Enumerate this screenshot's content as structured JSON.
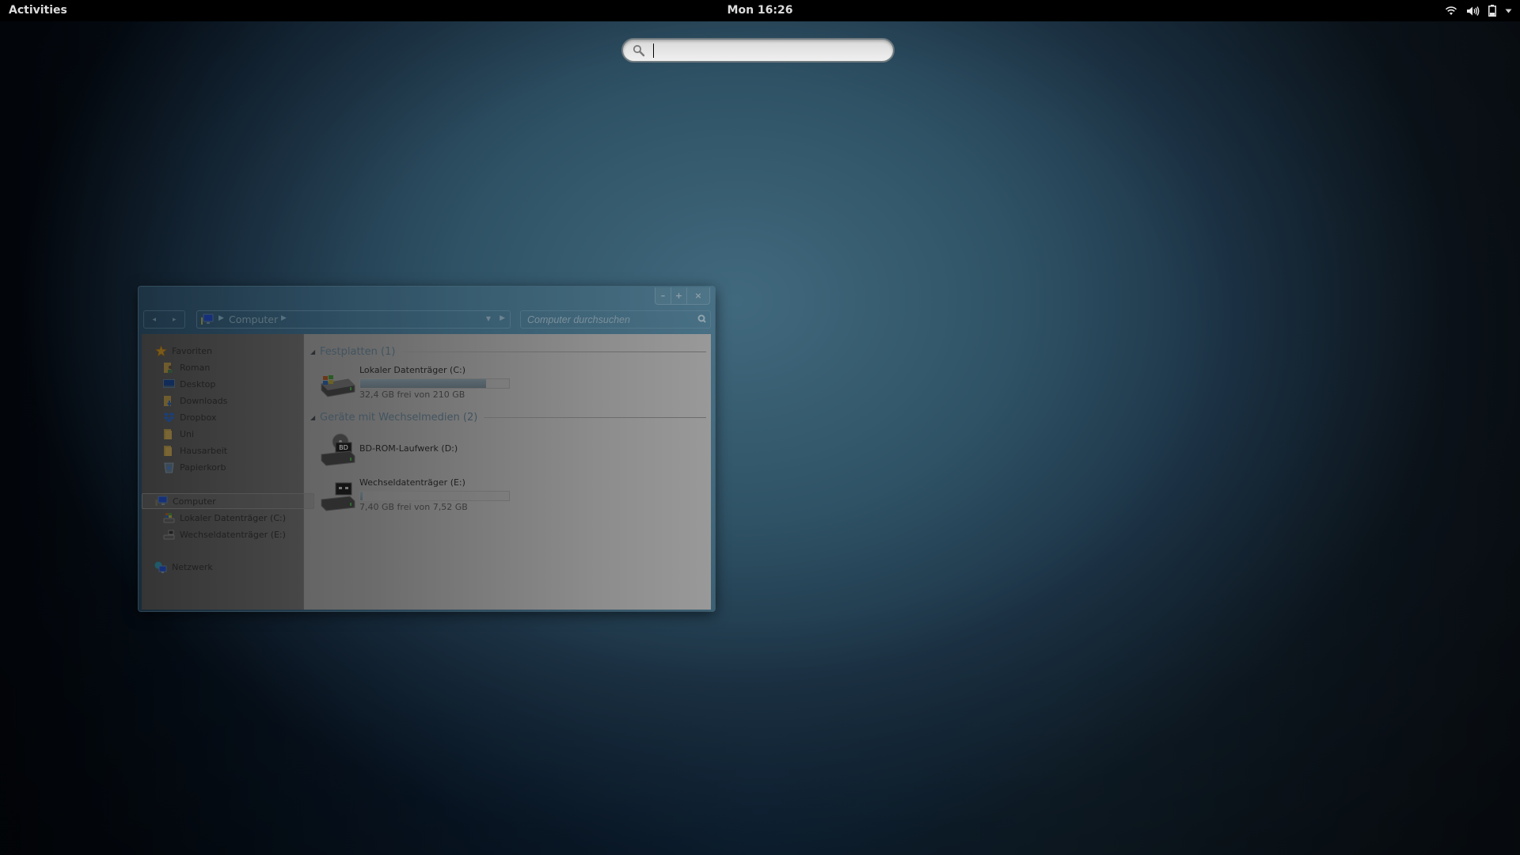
{
  "topbar": {
    "activities": "Activities",
    "clock": "Mon 16:26",
    "tray": [
      "wifi-icon",
      "volume-icon",
      "battery-icon",
      "menu-arrow-icon"
    ]
  },
  "overview_search": {
    "value": "",
    "icon": "search-icon"
  },
  "window": {
    "controls": {
      "minimize": "–",
      "maximize": "+",
      "close": "×"
    },
    "toolbar": {
      "back": "◂",
      "forward": "▸",
      "breadcrumb": [
        "Computer"
      ],
      "search_placeholder": "Computer durchsuchen"
    },
    "nav": {
      "favorites_label": "Favoriten",
      "favorites": [
        {
          "label": "Roman",
          "icon": "user-folder-icon"
        },
        {
          "label": "Desktop",
          "icon": "desktop-icon"
        },
        {
          "label": "Downloads",
          "icon": "downloads-folder-icon"
        },
        {
          "label": "Dropbox",
          "icon": "dropbox-icon"
        },
        {
          "label": "Uni",
          "icon": "folder-icon"
        },
        {
          "label": "Hausarbeit",
          "icon": "folder-icon"
        },
        {
          "label": "Papierkorb",
          "icon": "recycle-bin-icon"
        }
      ],
      "computer_label": "Computer",
      "computer_items": [
        {
          "label": "Lokaler Datenträger (C:)",
          "icon": "hard-drive-icon"
        },
        {
          "label": "Wechseldatenträger (E:)",
          "icon": "removable-drive-icon"
        }
      ],
      "network_label": "Netzwerk"
    },
    "groups": [
      {
        "title": "Festplatten (1)",
        "drives": [
          {
            "name": "Lokaler Datenträger (C:)",
            "status": "32,4 GB frei von 210 GB",
            "used_fraction": 0.846,
            "icon": "windows-hard-drive-icon"
          }
        ]
      },
      {
        "title": "Geräte mit Wechselmedien (2)",
        "drives": [
          {
            "name": "BD-ROM-Laufwerk (D:)",
            "status": "",
            "icon": "bd-rom-drive-icon"
          },
          {
            "name": "Wechseldatenträger (E:)",
            "status": "7,40 GB frei von 7,52 GB",
            "used_fraction": 0.016,
            "icon": "removable-drive-icon"
          }
        ]
      }
    ]
  }
}
